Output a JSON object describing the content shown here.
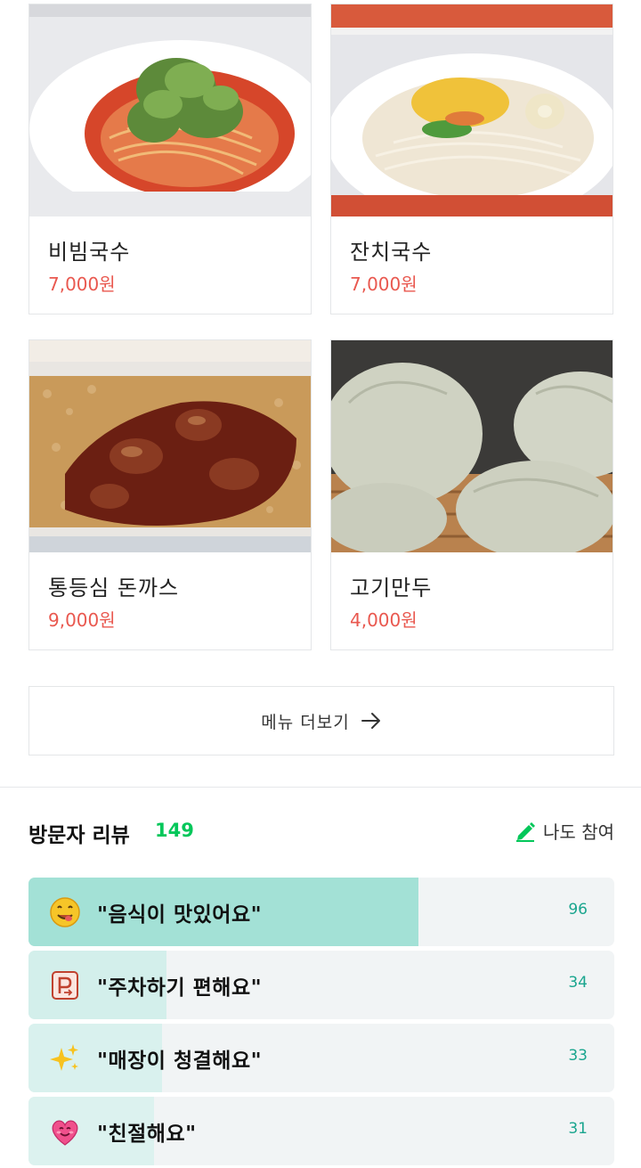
{
  "menu": {
    "items": [
      {
        "name": "비빔국수",
        "price": "7,000원",
        "photo": "bibim-guksu-photo"
      },
      {
        "name": "잔치국수",
        "price": "7,000원",
        "photo": "janchi-guksu-photo"
      },
      {
        "name": "통등심 돈까스",
        "price": "9,000원",
        "photo": "donkatsu-photo"
      },
      {
        "name": "고기만두",
        "price": "4,000원",
        "photo": "gogi-mandu-photo"
      }
    ],
    "more_label": "메뉴 더보기",
    "more_icon": "arrow-right-icon"
  },
  "reviews": {
    "title": "방문자 리뷰",
    "count": "149",
    "join_label": "나도 참여",
    "join_icon": "pencil-icon",
    "accent_color": "#03c75a",
    "price_color": "#e9584f",
    "keywords": [
      {
        "text": "\"음식이 맛있어요\"",
        "count": "96",
        "icon": "yum-face-icon",
        "fill_ratio": 0.665,
        "fill_color": "#a3e1d6"
      },
      {
        "text": "\"주차하기 편해요\"",
        "count": "34",
        "icon": "parking-icon",
        "fill_ratio": 0.235,
        "fill_color": "#d3efeb"
      },
      {
        "text": "\"매장이 청결해요\"",
        "count": "33",
        "icon": "sparkles-icon",
        "fill_ratio": 0.228,
        "fill_color": "#d9f1ee"
      },
      {
        "text": "\"친절해요\"",
        "count": "31",
        "icon": "heart-face-icon",
        "fill_ratio": 0.215,
        "fill_color": "#dcf2ef"
      }
    ]
  }
}
